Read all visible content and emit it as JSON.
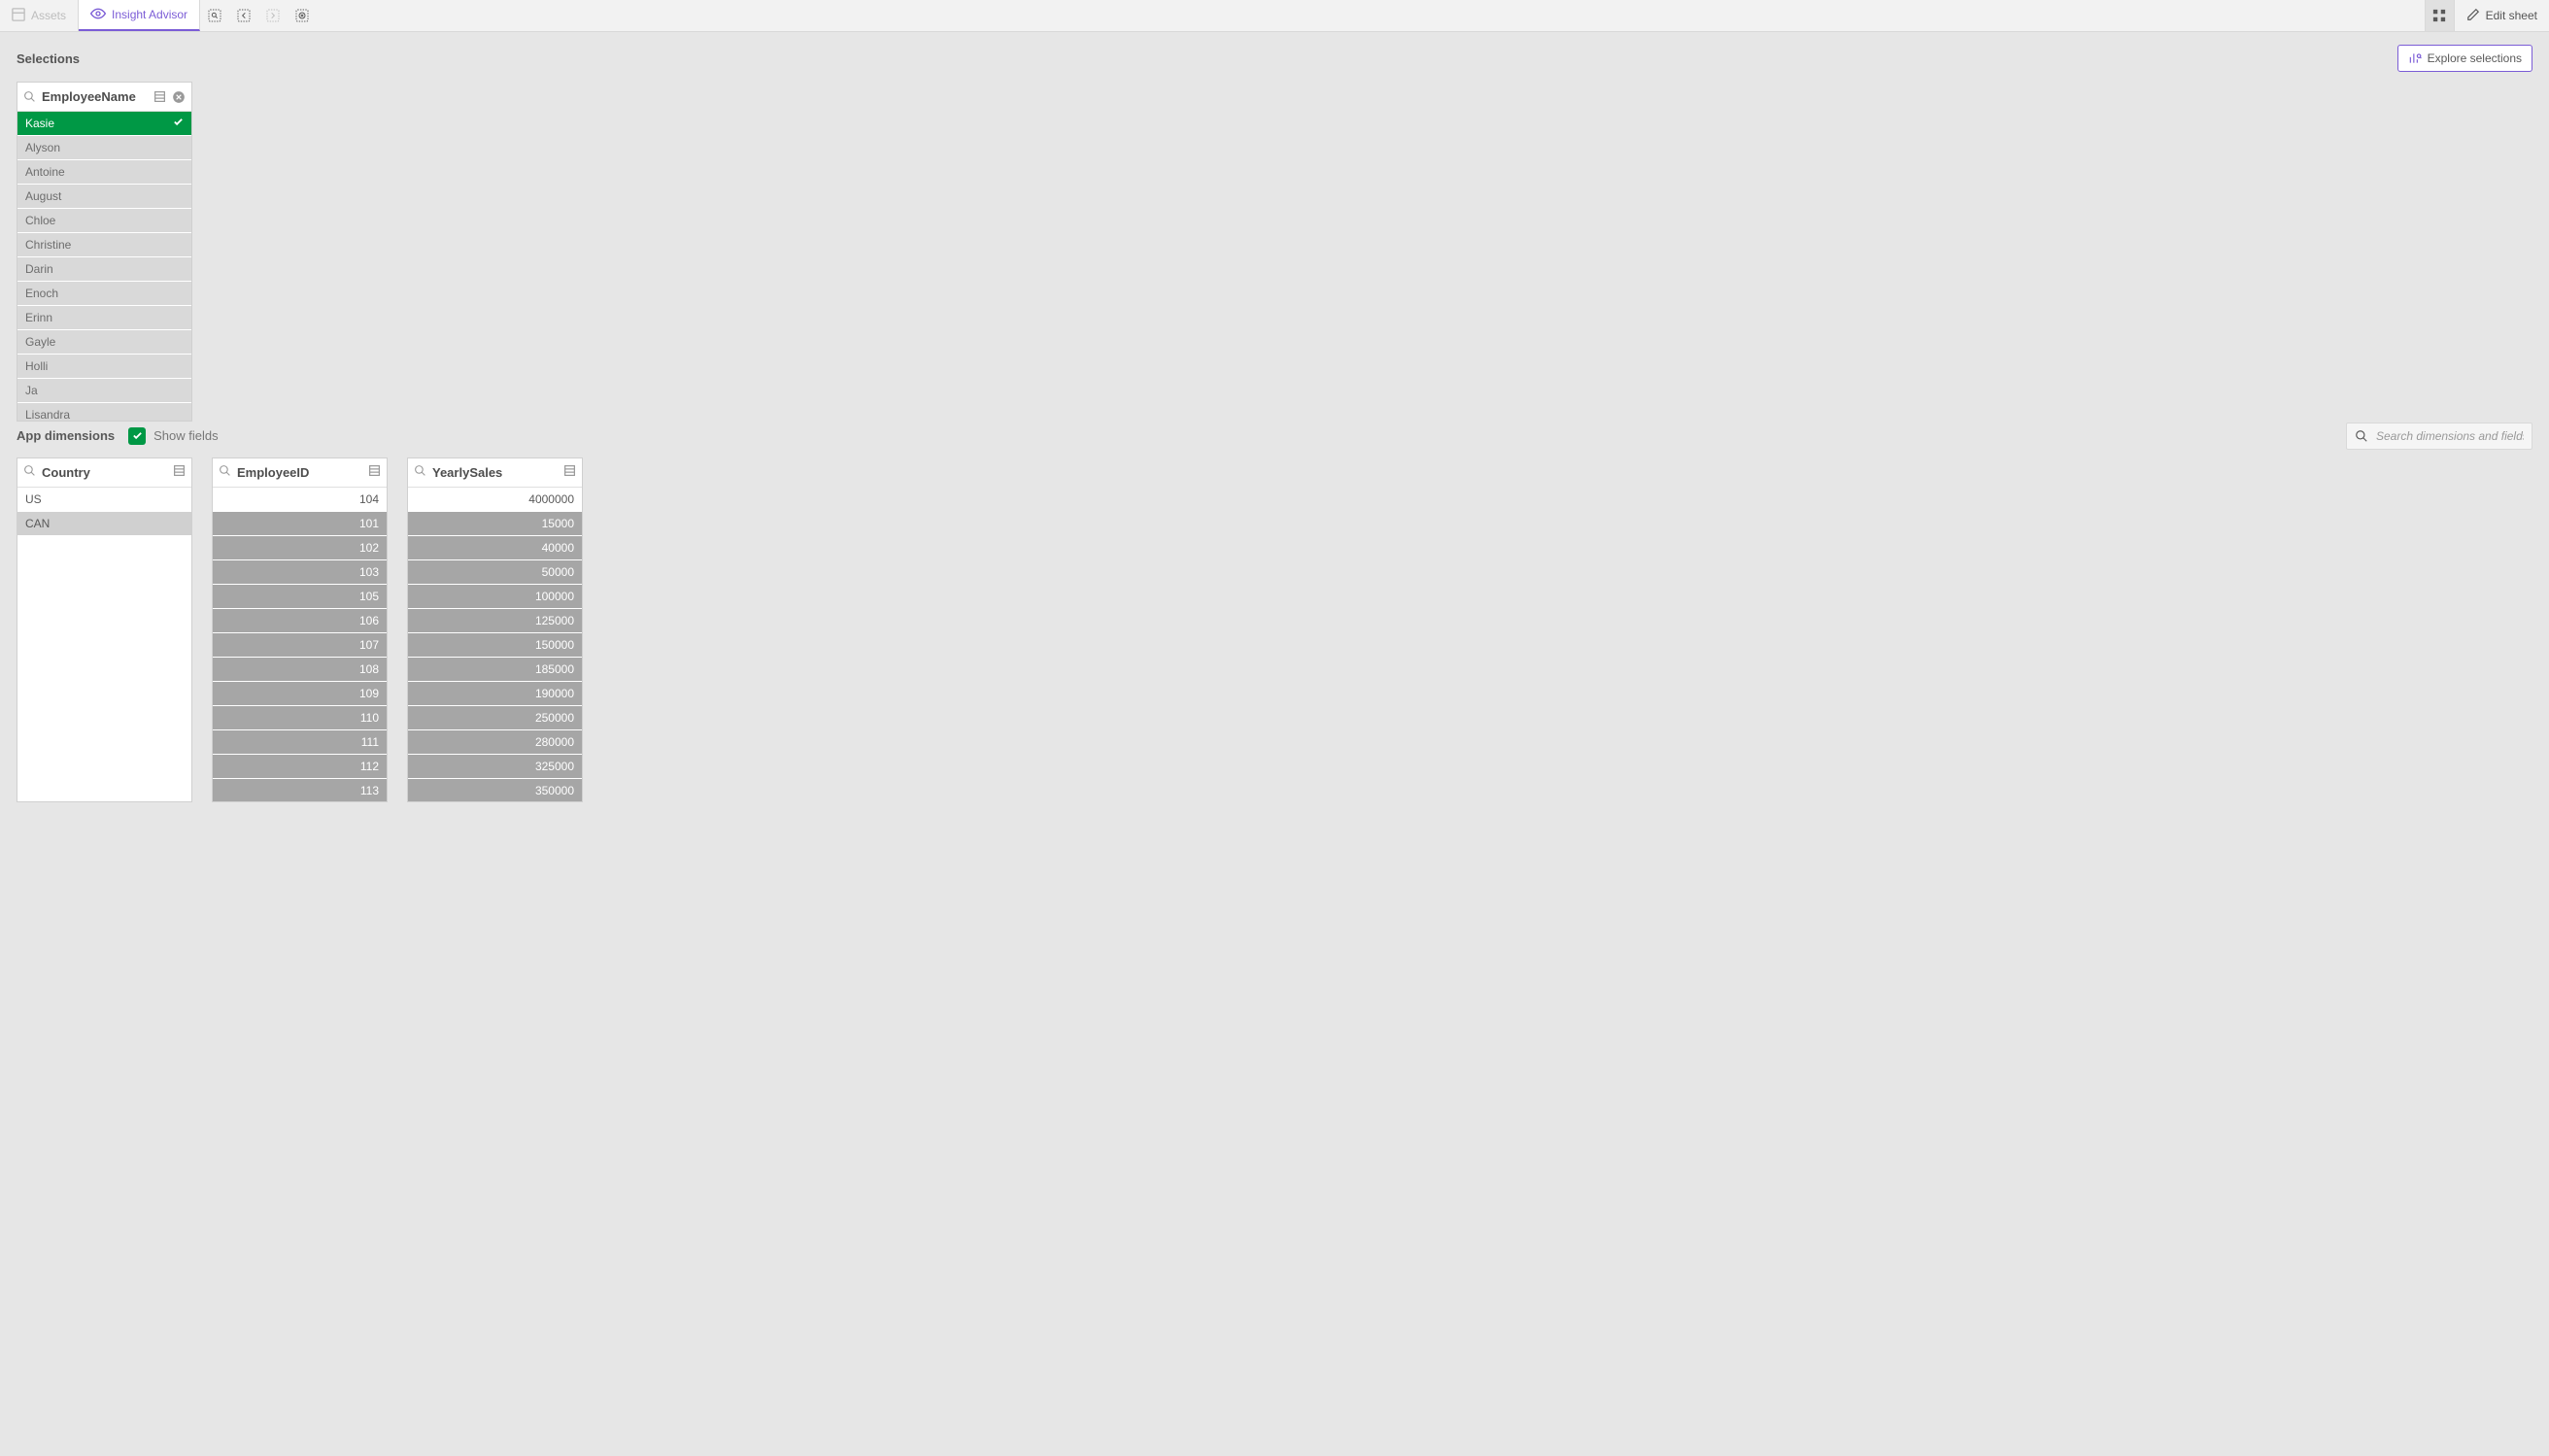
{
  "toolbar": {
    "assets": "Assets",
    "insight": "Insight Advisor",
    "edit_sheet": "Edit sheet"
  },
  "selections": {
    "heading": "Selections",
    "explore": "Explore selections",
    "listbox": {
      "field": "EmployeeName",
      "values": [
        {
          "label": "Kasie",
          "state": "selected"
        },
        {
          "label": "Alyson",
          "state": "excluded"
        },
        {
          "label": "Antoine",
          "state": "excluded"
        },
        {
          "label": "August",
          "state": "excluded"
        },
        {
          "label": "Chloe",
          "state": "excluded"
        },
        {
          "label": "Christine",
          "state": "excluded"
        },
        {
          "label": "Darin",
          "state": "excluded"
        },
        {
          "label": "Enoch",
          "state": "excluded"
        },
        {
          "label": "Erinn",
          "state": "excluded"
        },
        {
          "label": "Gayle",
          "state": "excluded"
        },
        {
          "label": "Holli",
          "state": "excluded"
        },
        {
          "label": "Ja",
          "state": "excluded"
        },
        {
          "label": "Lisandra",
          "state": "excluded"
        }
      ]
    }
  },
  "dimensions": {
    "heading": "App dimensions",
    "show_fields": "Show fields",
    "search_placeholder": "Search dimensions and fields",
    "lists": [
      {
        "field": "Country",
        "align": "left",
        "values": [
          {
            "label": "US",
            "state": "possible"
          },
          {
            "label": "CAN",
            "state": "alternative"
          }
        ]
      },
      {
        "field": "EmployeeID",
        "align": "right",
        "values": [
          {
            "label": "104",
            "state": "possible"
          },
          {
            "label": "101",
            "state": "excluded"
          },
          {
            "label": "102",
            "state": "excluded"
          },
          {
            "label": "103",
            "state": "excluded"
          },
          {
            "label": "105",
            "state": "excluded"
          },
          {
            "label": "106",
            "state": "excluded"
          },
          {
            "label": "107",
            "state": "excluded"
          },
          {
            "label": "108",
            "state": "excluded"
          },
          {
            "label": "109",
            "state": "excluded"
          },
          {
            "label": "110",
            "state": "excluded"
          },
          {
            "label": "111",
            "state": "excluded"
          },
          {
            "label": "112",
            "state": "excluded"
          },
          {
            "label": "113",
            "state": "excluded"
          }
        ]
      },
      {
        "field": "YearlySales",
        "align": "right",
        "values": [
          {
            "label": "4000000",
            "state": "possible"
          },
          {
            "label": "15000",
            "state": "excluded"
          },
          {
            "label": "40000",
            "state": "excluded"
          },
          {
            "label": "50000",
            "state": "excluded"
          },
          {
            "label": "100000",
            "state": "excluded"
          },
          {
            "label": "125000",
            "state": "excluded"
          },
          {
            "label": "150000",
            "state": "excluded"
          },
          {
            "label": "185000",
            "state": "excluded"
          },
          {
            "label": "190000",
            "state": "excluded"
          },
          {
            "label": "250000",
            "state": "excluded"
          },
          {
            "label": "280000",
            "state": "excluded"
          },
          {
            "label": "325000",
            "state": "excluded"
          },
          {
            "label": "350000",
            "state": "excluded"
          }
        ]
      }
    ]
  }
}
